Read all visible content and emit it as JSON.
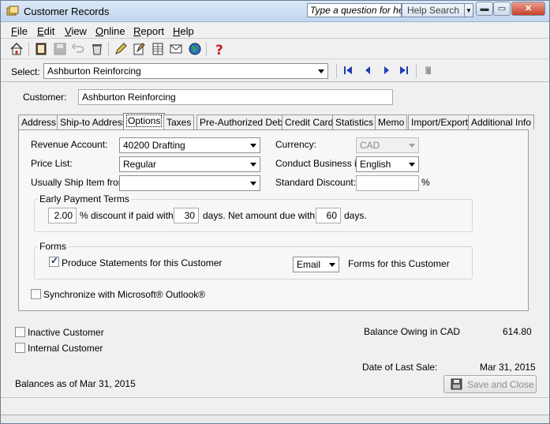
{
  "window": {
    "title": "Customer Records",
    "help_placeholder": "Type a question for help",
    "help_search_label": "Help Search",
    "minimize_glyph": "▬",
    "maximize_glyph": "▭",
    "close_glyph": "✕"
  },
  "menu": {
    "items": [
      "File",
      "Edit",
      "View",
      "Online",
      "Report",
      "Help"
    ]
  },
  "toolbar": {
    "icons": [
      "home-icon",
      "address-book-icon",
      "save-icon",
      "undo-icon",
      "recycle-bin-icon",
      "pencil-icon",
      "edit-document-icon",
      "spreadsheet-icon",
      "envelope-icon",
      "globe-icon",
      "help-question-icon"
    ]
  },
  "select_row": {
    "label": "Select:",
    "value": "Ashburton Reinforcing"
  },
  "customer": {
    "label": "Customer:",
    "value": "Ashburton Reinforcing"
  },
  "tabs": [
    "Address",
    "Ship-to Address",
    "Options",
    "Taxes",
    "Pre-Authorized Debit",
    "Credit Card",
    "Statistics",
    "Memo",
    "Import/Export",
    "Additional Info"
  ],
  "active_tab": "Options",
  "options": {
    "revenue_account_label": "Revenue Account:",
    "revenue_account_value": "40200 Drafting",
    "currency_label": "Currency:",
    "currency_value": "CAD",
    "price_list_label": "Price List:",
    "price_list_value": "Regular",
    "conduct_business_label": "Conduct Business in:",
    "conduct_business_value": "English",
    "ship_item_label": "Usually Ship Item from:",
    "ship_item_value": "",
    "standard_discount_label": "Standard Discount:",
    "standard_discount_value": "",
    "percent_sign": "%"
  },
  "early_payment": {
    "legend": "Early Payment Terms",
    "discount_value": "2.00",
    "discount_text": "% discount if paid within",
    "days_value": "30",
    "net_text": "days. Net amount due within",
    "net_days_value": "60",
    "days_label": "days."
  },
  "forms": {
    "legend": "Forms",
    "produce_statements_label": "Produce Statements for this Customer",
    "produce_statements_checked": true,
    "delivery_value": "Email",
    "forms_for_label": "Forms for this Customer"
  },
  "sync_outlook_label": "Synchronize with Microsoft® Outlook®",
  "sync_outlook_checked": false,
  "inactive_label": "Inactive Customer",
  "inactive_checked": false,
  "internal_label": "Internal Customer",
  "internal_checked": false,
  "balance_label": "Balance Owing in CAD",
  "balance_value": "614.80",
  "last_sale_label": "Date of Last Sale:",
  "last_sale_value": "Mar 31, 2015",
  "balances_as_of": "Balances as of Mar 31, 2015",
  "save_close_label": "Save and Close",
  "colors": {
    "titlebar": "#c2d6ee",
    "close_button": "#c8402a",
    "nav_arrows": "#1f3fb5"
  }
}
